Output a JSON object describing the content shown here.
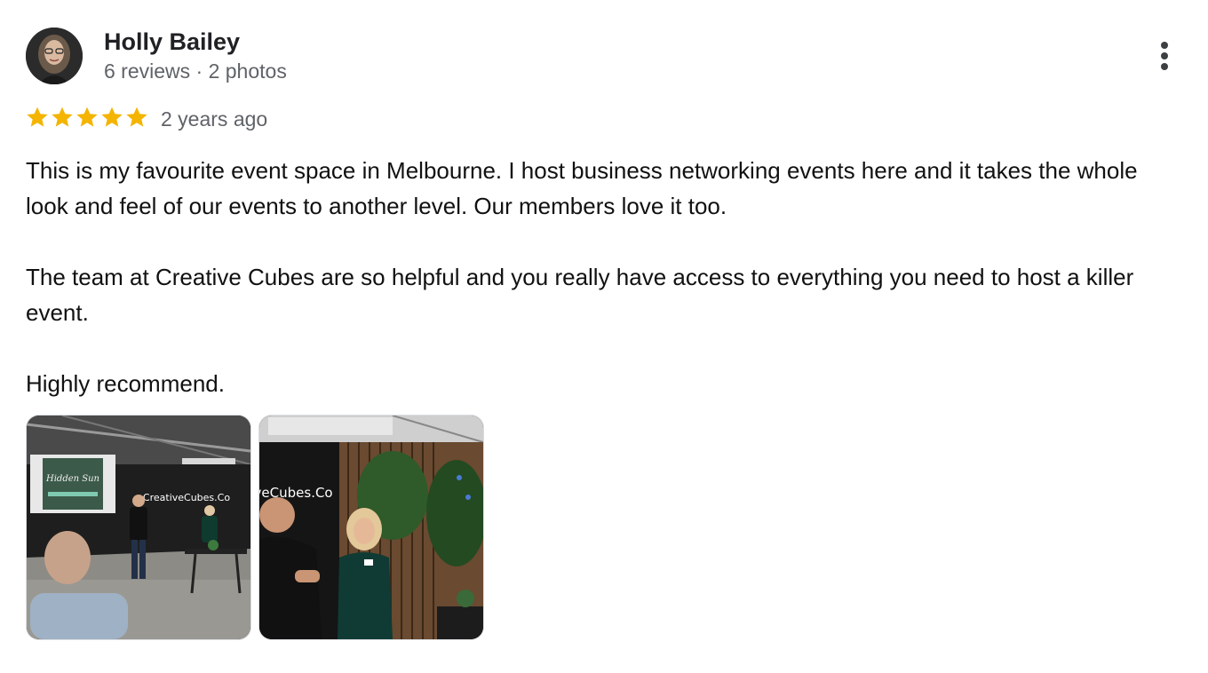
{
  "reviewer": {
    "name": "Holly Bailey",
    "meta": "6 reviews · 2 photos"
  },
  "review": {
    "rating": 5,
    "rating_max": 5,
    "date": "2 years ago",
    "paragraphs": [
      "This is my favourite event space in Melbourne. I host business networking events here and it takes the whole look and feel of our events to another level. Our members love it too.",
      "The team at Creative Cubes are so helpful and you really have access to everything you need to host a killer event.",
      "Highly recommend."
    ]
  },
  "photos": [
    {
      "id": "photo-1",
      "signage_text": "CreativeCubes.Co",
      "screen_text": "Hidden Sun"
    },
    {
      "id": "photo-2",
      "signage_text": "iveCubes.Co"
    }
  ],
  "colors": {
    "star": "#F4B400",
    "name": "#202124",
    "meta": "#5F6368",
    "body": "#111111"
  },
  "icons": {
    "more": "more-vert-icon",
    "star": "star-icon"
  }
}
